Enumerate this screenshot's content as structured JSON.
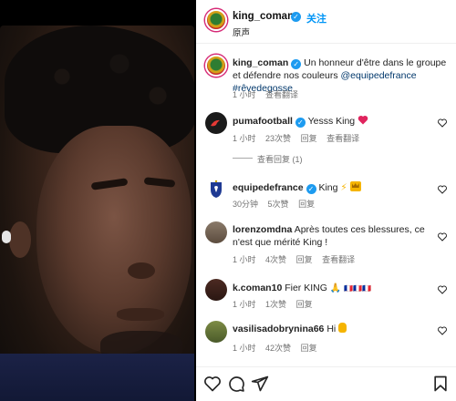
{
  "post": {
    "author": "king_coman",
    "follow_label": "关注",
    "subtitle": "原声"
  },
  "caption": {
    "username": "king_coman",
    "text": "Un honneur d'être dans le groupe et défendre nos couleurs",
    "mention": "@equipedefrance",
    "hashtag": "#rêvedegosse",
    "time": "1 小时",
    "translate": "查看翻译"
  },
  "comments": [
    {
      "username": "pumafootball",
      "text": "Yesss King",
      "emoji": "heart",
      "time": "1 小时",
      "likes": "23次赞",
      "reply": "回复",
      "translate": "查看翻译",
      "replies_label": "查看回复 (1)"
    },
    {
      "username": "equipedefrance",
      "text": "King",
      "emoji": "bolt-crown",
      "time": "30分钟",
      "likes": "5次赞",
      "reply": "回复"
    },
    {
      "username": "lorenzomdna",
      "text": "Après toutes ces blessures, ce n'est que mérité King !",
      "time": "1 小时",
      "likes": "4次赞",
      "reply": "回复",
      "translate": "查看翻译"
    },
    {
      "username": "k.coman10",
      "text": "Fier KING",
      "emoji": "pray",
      "flags": "🇫🇷🇫🇷🇫🇷",
      "time": "1 小时",
      "likes": "1次赞",
      "reply": "回复"
    },
    {
      "username": "vasilisadobrynina66",
      "text": "Hi",
      "emoji": "pray-gold",
      "time": "1 小时",
      "likes": "42次赞",
      "reply": "回复"
    }
  ],
  "icons": {
    "heart": "heart-icon",
    "comment": "comment-icon",
    "share": "share-icon",
    "save": "bookmark-icon",
    "more": "more-icon"
  },
  "colors": {
    "link": "#00376b",
    "follow": "#0095f6",
    "verified": "#1d9bf0",
    "heart_red": "#ed4956"
  }
}
